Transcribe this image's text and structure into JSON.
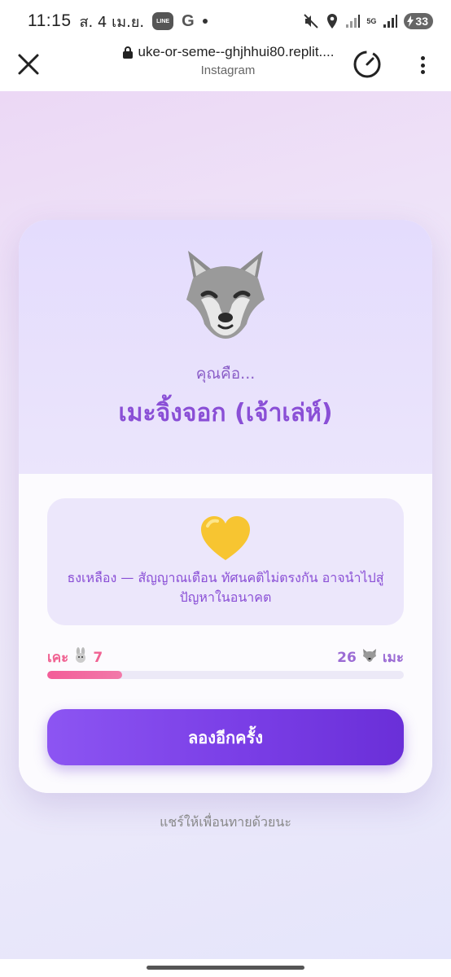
{
  "status_bar": {
    "time": "11:15",
    "date": "ส. 4 เม.ย.",
    "line_label": "LINE",
    "g_label": "G",
    "network": "5G",
    "battery": "33"
  },
  "browser": {
    "url": "uke-or-seme--ghjhhui80.replit....",
    "subtitle": "Instagram"
  },
  "result": {
    "intro": "คุณคือ...",
    "title": "เมะจิ้งจอก (เจ้าเล่ห์)",
    "emoji_icon": "wolf-icon"
  },
  "flag": {
    "icon": "yellow-heart-icon",
    "text": "ธงเหลือง — สัญญาณเตือน ทัศนคติไม่ตรงกัน อาจนำไปสู่ปัญหาในอนาคต"
  },
  "scores": {
    "uke_label": "เคะ",
    "uke_value": "7",
    "seme_label": "เมะ",
    "seme_value": "26",
    "uke_fraction": 0.21
  },
  "actions": {
    "retry_label": "ลองอีกครั้ง",
    "share_text": "แชร์ให้เพื่อนทายด้วยนะ"
  },
  "colors": {
    "accent": "#8a4fd6",
    "uke": "#f06292",
    "button": "#7a3ee6"
  }
}
